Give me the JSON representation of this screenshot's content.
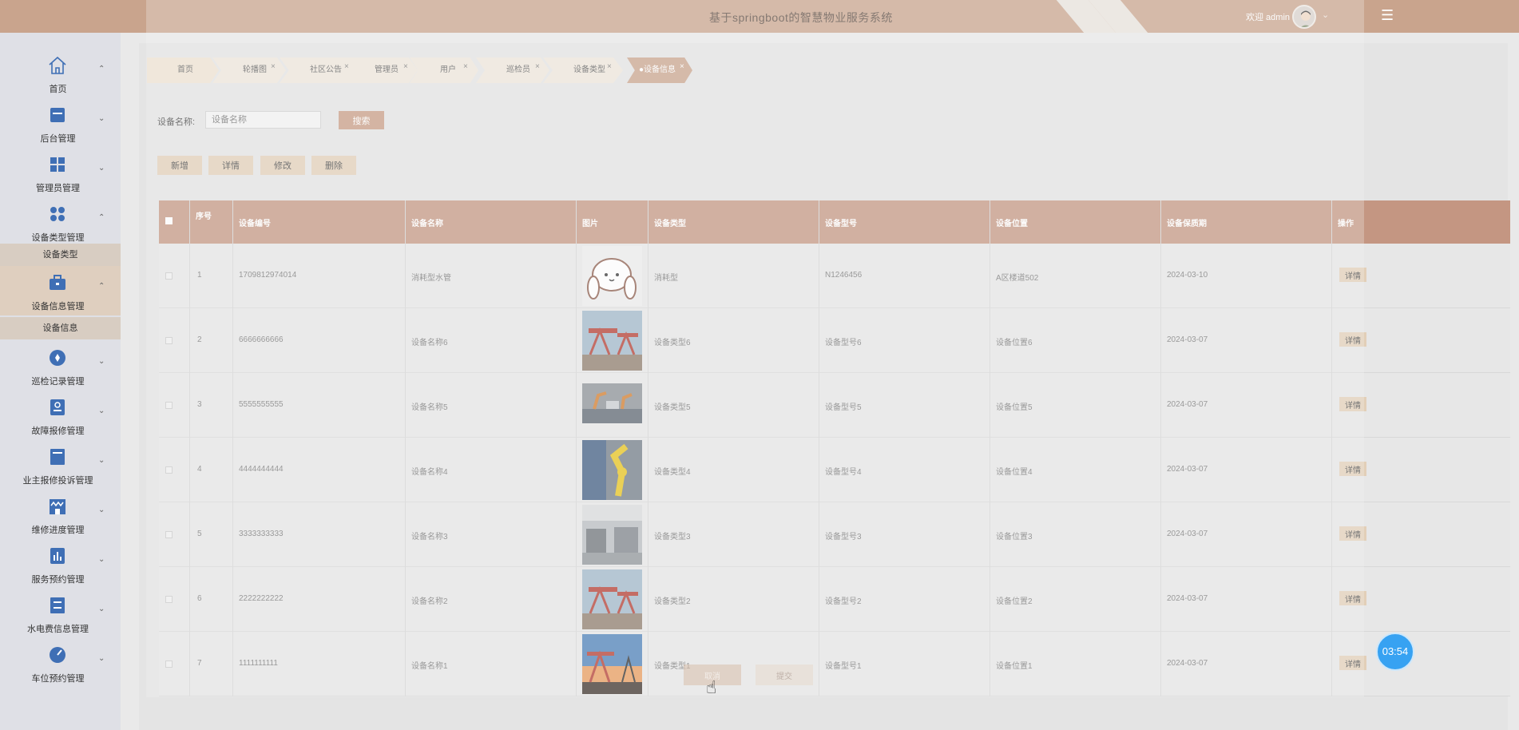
{
  "header": {
    "title": "基于springboot的智慧物业服务系统",
    "welcome": "欢迎 admin",
    "avatar_icon": "user-avatar",
    "dropdown_icon": "chevron-down-icon",
    "menu_icon": "hamburger-menu-icon",
    "accent_color": "#c9a48d"
  },
  "sidebar": {
    "items": [
      {
        "label": "首页",
        "icon": "home-icon",
        "arrow": "^"
      },
      {
        "label": "后台管理",
        "icon": "folder-icon",
        "arrow": "v"
      },
      {
        "label": "管理员管理",
        "icon": "grid-icon",
        "arrow": "v"
      },
      {
        "label": "设备类型管理",
        "icon": "apps-icon",
        "arrow": "^"
      },
      {
        "label": "设备信息管理",
        "icon": "briefcase-icon",
        "arrow": "^"
      },
      {
        "label": "巡检记录管理",
        "icon": "compass-icon",
        "arrow": "v"
      },
      {
        "label": "故障报修管理",
        "icon": "id-card-icon",
        "arrow": "v"
      },
      {
        "label": "业主报修投诉管理",
        "icon": "form-icon",
        "arrow": "v"
      },
      {
        "label": "维修进度管理",
        "icon": "store-icon",
        "arrow": "v"
      },
      {
        "label": "服务预约管理",
        "icon": "chart-icon",
        "arrow": "v"
      },
      {
        "label": "水电费信息管理",
        "icon": "archive-icon",
        "arrow": "v"
      },
      {
        "label": "车位预约管理",
        "icon": "gauge-icon",
        "arrow": "v"
      }
    ],
    "sub_device_type": "设备类型",
    "sub_device_info": "设备信息"
  },
  "tabs": [
    {
      "label": "首页",
      "closable": false
    },
    {
      "label": "轮播图",
      "closable": true
    },
    {
      "label": "社区公告",
      "closable": true
    },
    {
      "label": "管理员",
      "closable": true
    },
    {
      "label": "用户",
      "closable": true
    },
    {
      "label": "巡检员",
      "closable": true
    },
    {
      "label": "设备类型",
      "closable": true
    },
    {
      "label": "●设备信息",
      "closable": true
    }
  ],
  "search": {
    "label": "设备名称:",
    "placeholder": "设备名称",
    "button": "搜索"
  },
  "actions": {
    "add": "新增",
    "detail": "详情",
    "edit": "修改",
    "delete": "删除"
  },
  "table": {
    "headers": [
      "序号",
      "设备编号",
      "设备名称",
      "图片",
      "设备类型",
      "设备型号",
      "设备位置",
      "设备保质期",
      "操作"
    ],
    "rows": [
      {
        "no": "1",
        "code": "1709812974014",
        "name": "消耗型水管",
        "image": "cartoon-bunny-image",
        "type": "消耗型",
        "model": "N1246456",
        "location": "A区楼道502",
        "expiry": "2024-03-10",
        "op": "详情"
      },
      {
        "no": "2",
        "code": "6666666666",
        "name": "设备名称6",
        "image": "oil-pump-image",
        "type": "设备类型6",
        "model": "设备型号6",
        "location": "设备位置6",
        "expiry": "2024-03-07",
        "op": "详情"
      },
      {
        "no": "3",
        "code": "5555555555",
        "name": "设备名称5",
        "image": "factory-robot-image",
        "type": "设备类型5",
        "model": "设备型号5",
        "location": "设备位置5",
        "expiry": "2024-03-07",
        "op": "详情"
      },
      {
        "no": "4",
        "code": "4444444444",
        "name": "设备名称4",
        "image": "yellow-robot-arm-image",
        "type": "设备类型4",
        "model": "设备型号4",
        "location": "设备位置4",
        "expiry": "2024-03-07",
        "op": "详情"
      },
      {
        "no": "5",
        "code": "3333333333",
        "name": "设备名称3",
        "image": "production-line-image",
        "type": "设备类型3",
        "model": "设备型号3",
        "location": "设备位置3",
        "expiry": "2024-03-07",
        "op": "详情"
      },
      {
        "no": "6",
        "code": "2222222222",
        "name": "设备名称2",
        "image": "oil-pump-image",
        "type": "设备类型2",
        "model": "设备型号2",
        "location": "设备位置2",
        "expiry": "2024-03-07",
        "op": "详情"
      },
      {
        "no": "7",
        "code": "1111111111",
        "name": "设备名称1",
        "image": "oil-derrick-sunset-image",
        "type": "设备类型1",
        "model": "设备型号1",
        "location": "设备位置1",
        "expiry": "2024-03-07",
        "op": "详情"
      }
    ]
  },
  "modal_buttons": {
    "cancel": "取消",
    "submit": "提交"
  },
  "timer": "03:54"
}
